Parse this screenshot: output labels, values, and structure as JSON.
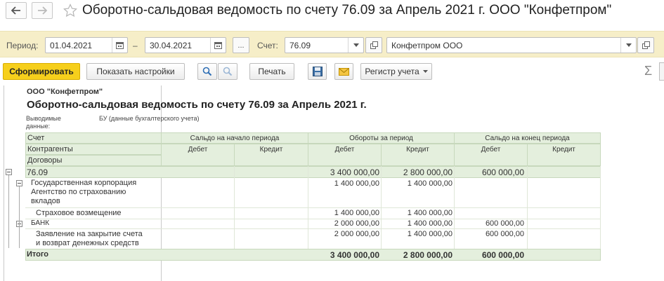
{
  "window": {
    "title": "Оборотно-сальдовая ведомость по счету 76.09 за Апрель 2021 г. ООО \"Конфетпром\""
  },
  "filters": {
    "period_label": "Период:",
    "date_from": "01.04.2021",
    "dash": "–",
    "date_to": "30.04.2021",
    "more": "...",
    "account_label": "Счет:",
    "account": "76.09",
    "organization": "Конфетпром ООО"
  },
  "toolbar": {
    "generate": "Сформировать",
    "show_settings": "Показать настройки",
    "print": "Печать",
    "register": "Регистр учета",
    "sum": "Σ"
  },
  "report": {
    "org": "ООО \"Конфетпром\"",
    "title": "Оборотно-сальдовая ведомость по счету 76.09 за Апрель 2021 г.",
    "output_label_1": "Выводимые",
    "output_label_2": "данные:",
    "output_value": "БУ (данные бухгалтерского учета)",
    "headers": {
      "account": "Счет",
      "counterparties": "Контрагенты",
      "contracts": "Договоры",
      "opening": "Сальдо на начало периода",
      "turnover": "Обороты за период",
      "closing": "Сальдо на конец периода",
      "debit": "Дебет",
      "credit": "Кредит"
    },
    "rows": [
      {
        "name": "76.09",
        "turn_debit": "3 400 000,00",
        "turn_credit": "2 800 000,00",
        "close_debit": "600 000,00"
      },
      {
        "name_1": "Государственная корпорация",
        "name_2": "Агентство по страхованию",
        "name_3": "вкладов",
        "turn_debit": "1 400 000,00",
        "turn_credit": "1 400 000,00"
      },
      {
        "name": "Страховое возмещение",
        "turn_debit": "1 400 000,00",
        "turn_credit": "1 400 000,00"
      },
      {
        "name": "БАНК",
        "turn_debit": "2 000 000,00",
        "turn_credit": "1 400 000,00",
        "close_debit": "600 000,00"
      },
      {
        "name_1": "Заявление на закрытие счета",
        "name_2": "и возврат денежных средств",
        "turn_debit": "2 000 000,00",
        "turn_credit": "1 400 000,00",
        "close_debit": "600 000,00"
      }
    ],
    "total": {
      "name": "Итого",
      "turn_debit": "3 400 000,00",
      "turn_credit": "2 800 000,00",
      "close_debit": "600 000,00"
    }
  }
}
